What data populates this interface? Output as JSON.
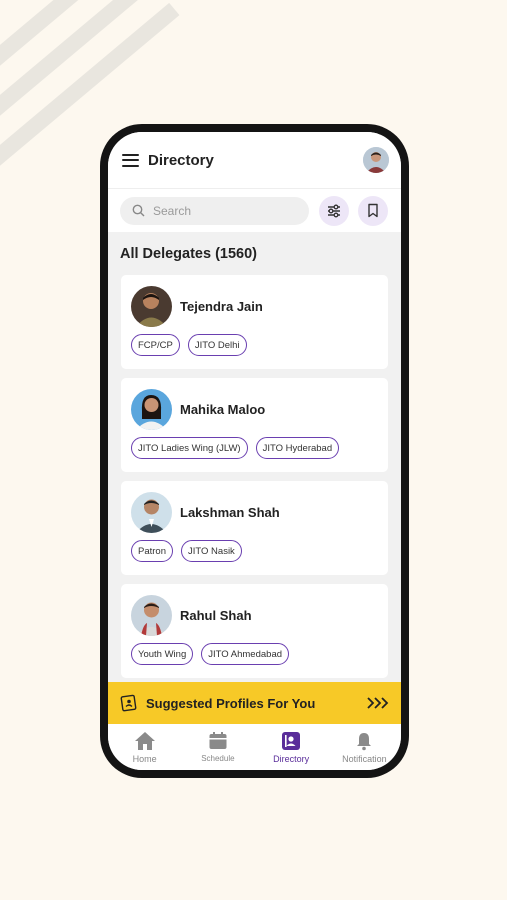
{
  "app": {
    "title": "Directory"
  },
  "search": {
    "placeholder": "Search"
  },
  "section": {
    "title": "All Delegates (1560)"
  },
  "delegates": [
    {
      "name": "Tejendra Jain",
      "tags": [
        "FCP/CP",
        "JITO Delhi"
      ]
    },
    {
      "name": "Mahika Maloo",
      "tags": [
        "JITO Ladies Wing (JLW)",
        "JITO Hyderabad"
      ]
    },
    {
      "name": "Lakshman Shah",
      "tags": [
        "Patron",
        "JITO Nasik"
      ]
    },
    {
      "name": "Rahul Shah",
      "tags": [
        "Youth Wing",
        "JITO Ahmedabad"
      ]
    }
  ],
  "suggest": {
    "label": "Suggested Profiles For You",
    "icon": "id-card-icon"
  },
  "tabs": [
    {
      "label": "Home",
      "icon": "home-icon"
    },
    {
      "label": "Schedule",
      "icon": "calendar-icon"
    },
    {
      "label": "Directory",
      "icon": "directory-icon"
    },
    {
      "label": "Notification",
      "icon": "bell-icon"
    }
  ],
  "colors": {
    "accent": "#5a2d9a",
    "banner": "#f7c927",
    "background": "#fdf8ef"
  }
}
